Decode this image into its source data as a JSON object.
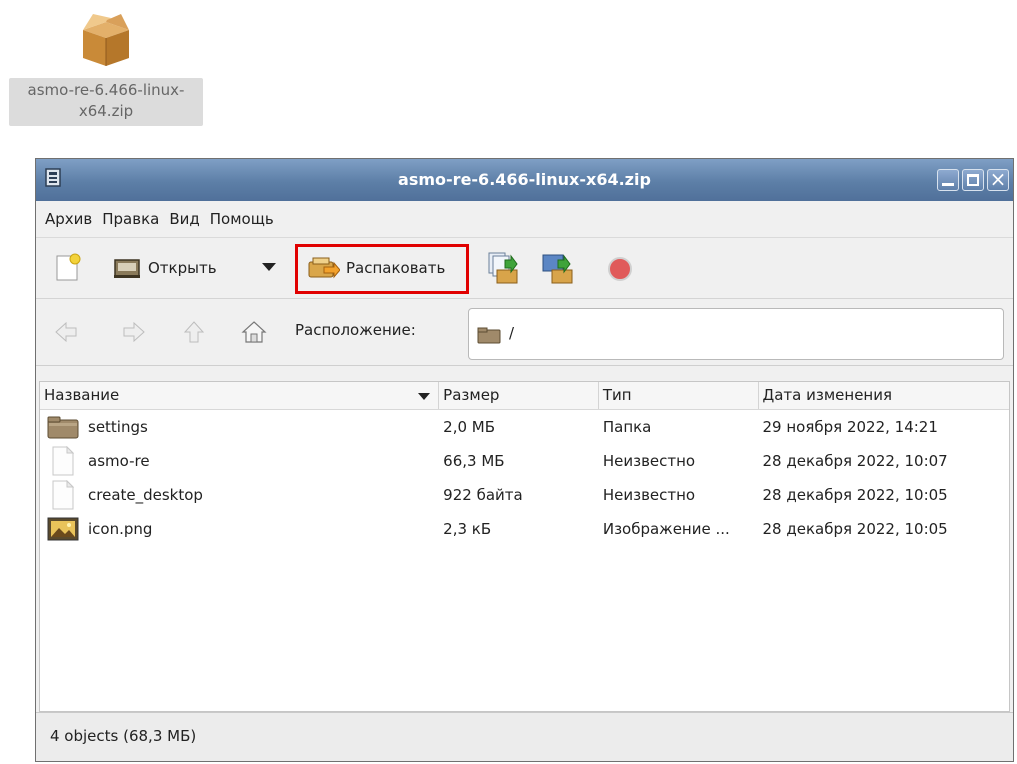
{
  "desktop": {
    "icon_name": "package-zip-icon",
    "label": "asmo-re-6.466-linux-x64.zip"
  },
  "window": {
    "title": "asmo-re-6.466-linux-x64.zip",
    "controls": {
      "minimize": "minimize",
      "maximize": "maximize",
      "close": "×"
    }
  },
  "menu": [
    "Архив",
    "Правка",
    "Вид",
    "Помощь"
  ],
  "toolbar": {
    "open_label": "Открыть",
    "extract_label": "Распаковать",
    "highlight_color": "#e00000"
  },
  "location": {
    "label": "Расположение:",
    "path": "/"
  },
  "table": {
    "columns": [
      "Название",
      "Размер",
      "Тип",
      "Дата изменения"
    ],
    "rows": [
      {
        "icon": "folder-icon",
        "name": "settings",
        "size": "2,0 МБ",
        "type": "Папка",
        "date": "29 ноября 2022, 14:21"
      },
      {
        "icon": "file-icon",
        "name": "asmo-re",
        "size": "66,3 МБ",
        "type": "Неизвестно",
        "date": "28 декабря 2022, 10:07"
      },
      {
        "icon": "file-icon",
        "name": "create_desktop",
        "size": "922 байта",
        "type": "Неизвестно",
        "date": "28 декабря 2022, 10:05"
      },
      {
        "icon": "image-icon",
        "name": "icon.png",
        "size": "2,3 кБ",
        "type": "Изображение ...",
        "date": "28 декабря 2022, 10:05"
      }
    ]
  },
  "status": "4 objects (68,3 МБ)"
}
